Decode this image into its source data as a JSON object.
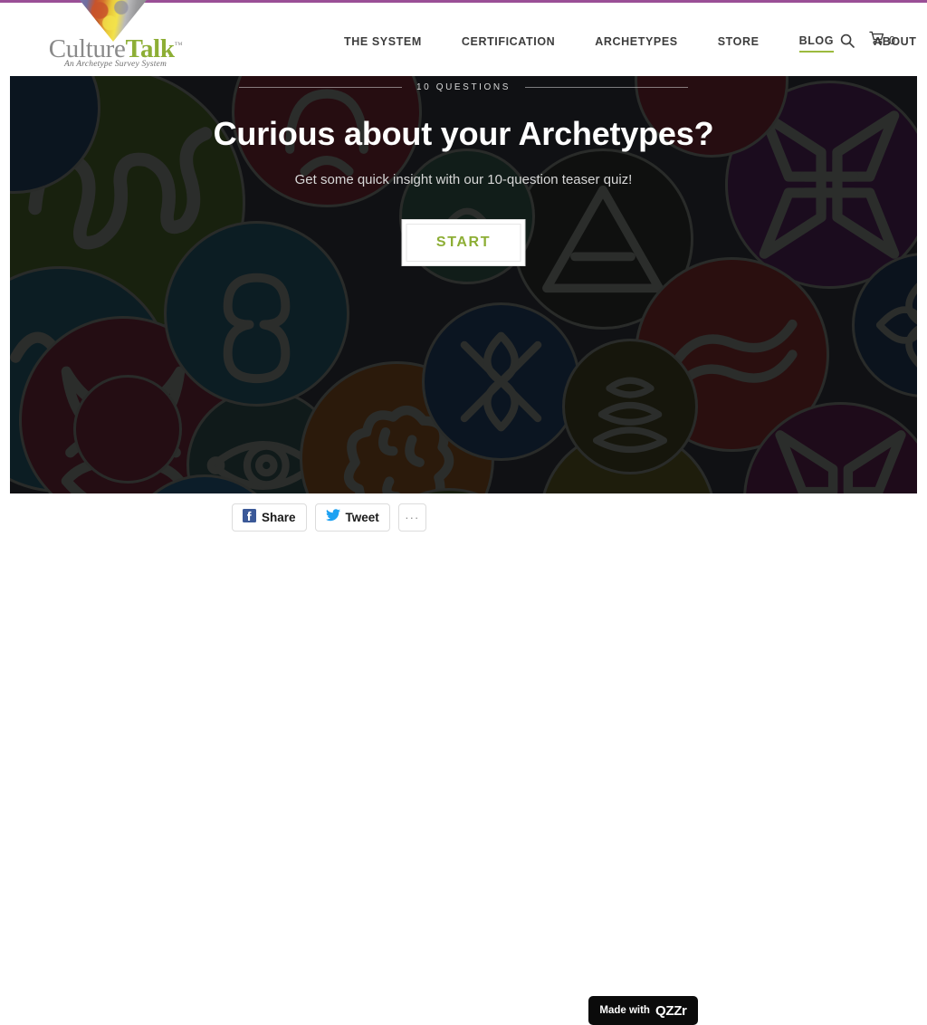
{
  "theme": {
    "accent_purple": "#9a4f96",
    "brand_green": "#8dae35",
    "nav_active_underline": "#9cba3e",
    "hero_background": "#1b1d22",
    "badge_background": "#0b0b0b"
  },
  "header": {
    "logo": {
      "name_part1": "Culture",
      "name_part2": "Talk",
      "trademark": "™",
      "tagline": "An Archetype Survey System",
      "triangle_icon": "inverted-triangle-colorful"
    },
    "nav_items": [
      {
        "label": "THE SYSTEM",
        "active": false
      },
      {
        "label": "CERTIFICATION",
        "active": false
      },
      {
        "label": "ARCHETYPES",
        "active": false
      },
      {
        "label": "STORE",
        "active": false
      },
      {
        "label": "BLOG",
        "active": true
      },
      {
        "label": "ABOUT",
        "active": false
      }
    ],
    "tools": {
      "search_icon": "search-icon",
      "cart_icon": "shopping-cart-icon",
      "cart_count": "0"
    }
  },
  "quiz": {
    "eyebrow": "10 QUESTIONS",
    "title": "Curious about your Archetypes?",
    "subtitle": "Get some quick insight with our 10-question teaser quiz!",
    "start_label": "START"
  },
  "footer": {
    "share_buttons": [
      {
        "label": "Share",
        "icon": "facebook-icon"
      },
      {
        "label": "Tweet",
        "icon": "twitter-icon"
      }
    ],
    "more_label": "···",
    "badge": {
      "prefix": "Made with",
      "brand": "QZZr"
    }
  }
}
